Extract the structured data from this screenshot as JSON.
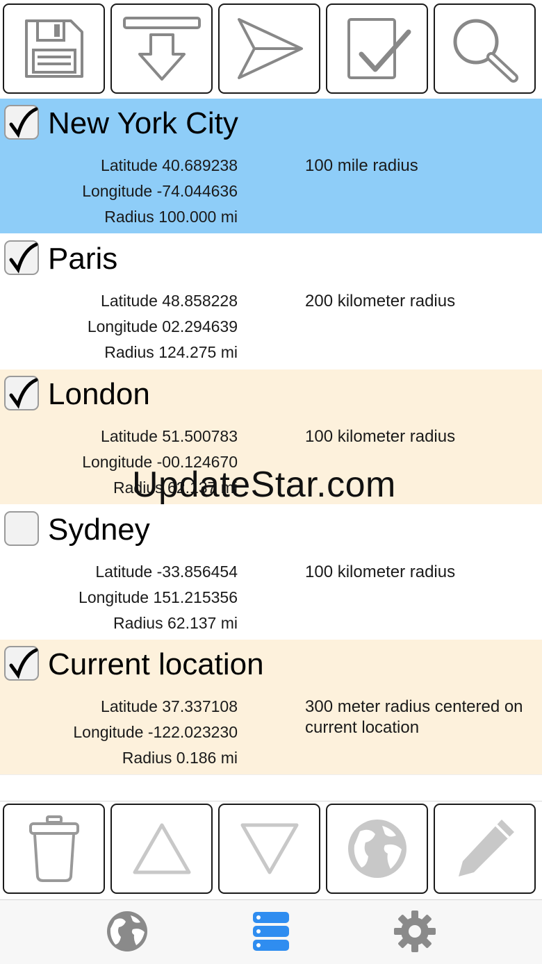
{
  "colors": {
    "selected_row": "#8ecdf8",
    "alt_row": "#fdf1dc",
    "white_row": "#ffffff",
    "tab_active": "#2f8df0",
    "tab_inactive": "#8a8a8a"
  },
  "top_toolbar": {
    "buttons": [
      {
        "icon": "save-icon"
      },
      {
        "icon": "download-icon"
      },
      {
        "icon": "send-icon"
      },
      {
        "icon": "checklist-icon"
      },
      {
        "icon": "search-icon"
      }
    ]
  },
  "locations": [
    {
      "name": "New York City",
      "checked": true,
      "lat": "Latitude 40.689238",
      "lon": "Longitude -74.044636",
      "radius": "Radius 100.000 mi",
      "desc": "100 mile radius"
    },
    {
      "name": "Paris",
      "checked": true,
      "lat": "Latitude 48.858228",
      "lon": "Longitude 02.294639",
      "radius": "Radius 124.275 mi",
      "desc": "200 kilometer radius"
    },
    {
      "name": "London",
      "checked": true,
      "lat": "Latitude 51.500783",
      "lon": "Longitude -00.124670",
      "radius": "Radius 62.137 mi",
      "desc": "100 kilometer radius"
    },
    {
      "name": "Sydney",
      "checked": false,
      "lat": "Latitude -33.856454",
      "lon": "Longitude 151.215356",
      "radius": "Radius 62.137 mi",
      "desc": "100 kilometer radius"
    },
    {
      "name": "Current location",
      "checked": true,
      "lat": "Latitude 37.337108",
      "lon": "Longitude -122.023230",
      "radius": "Radius 0.186 mi",
      "desc": "300 meter radius centered on current location"
    }
  ],
  "watermark": "UpdateStar.com",
  "bottom_toolbar": {
    "buttons": [
      {
        "icon": "trash-icon"
      },
      {
        "icon": "move-up-icon"
      },
      {
        "icon": "move-down-icon"
      },
      {
        "icon": "globe-icon"
      },
      {
        "icon": "pencil-icon"
      }
    ]
  },
  "tabbar": {
    "tabs": [
      {
        "icon": "globe-tab-icon",
        "active": false
      },
      {
        "icon": "list-tab-icon",
        "active": true
      },
      {
        "icon": "settings-tab-icon",
        "active": false
      }
    ]
  }
}
